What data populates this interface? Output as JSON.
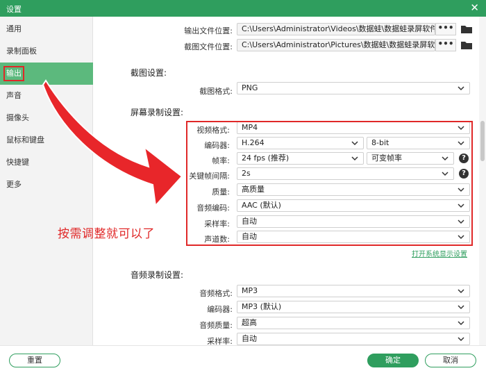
{
  "window": {
    "title": "设置",
    "close_symbol": "✕"
  },
  "sidebar": {
    "items": [
      {
        "label": "通用"
      },
      {
        "label": "录制面板"
      },
      {
        "label": "输出",
        "active": true
      },
      {
        "label": "声音"
      },
      {
        "label": "摄像头"
      },
      {
        "label": "鼠标和键盘"
      },
      {
        "label": "快捷键"
      },
      {
        "label": "更多"
      }
    ]
  },
  "output_paths": {
    "video": {
      "label": "输出文件位置:",
      "value": "C:\\Users\\Administrator\\Videos\\数据蛙\\数据蛙录屏软件"
    },
    "screenshot": {
      "label": "截图文件位置:",
      "value": "C:\\Users\\Administrator\\Pictures\\数据蛙\\数据蛙录屏软件"
    },
    "browse_label": "•••",
    "icon": "folder-icon"
  },
  "screenshot_settings": {
    "title": "截图设置:",
    "format": {
      "label": "截图格式:",
      "value": "PNG"
    }
  },
  "screen_recording": {
    "title": "屏幕录制设置:",
    "video_format": {
      "label": "视频格式:",
      "value": "MP4"
    },
    "encoder": {
      "label": "编码器:",
      "value": "H.264",
      "bitdepth": "8-bit"
    },
    "framerate": {
      "label": "帧率:",
      "value": "24 fps (推荐)",
      "mode": "可变帧率"
    },
    "keyframe": {
      "label": "关键帧间隔:",
      "value": "2s"
    },
    "quality": {
      "label": "质量:",
      "value": "高质量"
    },
    "audio_codec": {
      "label": "音频编码:",
      "value": "AAC (默认)"
    },
    "sample_rate": {
      "label": "采样率:",
      "value": "自动"
    },
    "channels": {
      "label": "声道数:",
      "value": "自动"
    },
    "system_display_link": "打开系统显示设置",
    "help_symbol": "?"
  },
  "audio_recording": {
    "title": "音频录制设置:",
    "format": {
      "label": "音频格式:",
      "value": "MP3"
    },
    "encoder": {
      "label": "编码器:",
      "value": "MP3 (默认)"
    },
    "quality": {
      "label": "音频质量:",
      "value": "超高"
    },
    "sample_rate": {
      "label": "采样率:",
      "value": "自动"
    }
  },
  "annotation": {
    "text": "按需调整就可以了",
    "color": "#e02828"
  },
  "footer": {
    "reset": "重置",
    "ok": "确定",
    "cancel": "取消"
  },
  "colors": {
    "accent": "#2f9e5e",
    "sidebar_active": "#5cb97d",
    "annotation_red": "#e02828"
  }
}
